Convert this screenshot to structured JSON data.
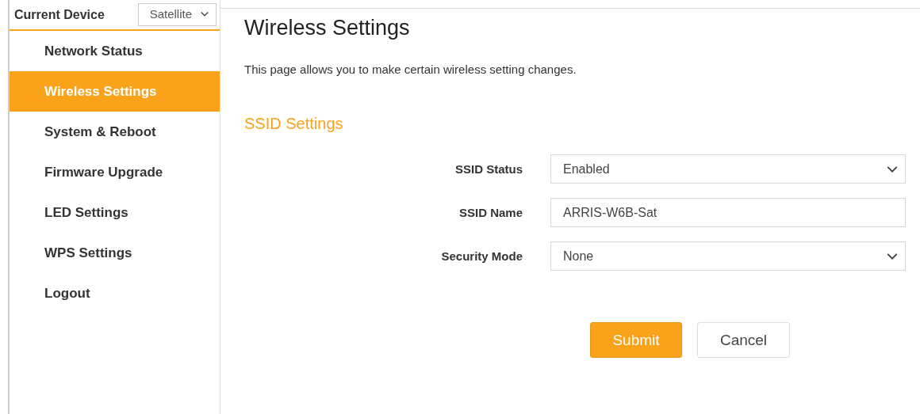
{
  "sidebar": {
    "device_label": "Current Device",
    "device_select": {
      "value": "Satellite"
    },
    "items": [
      {
        "label": "Network Status",
        "selected": false
      },
      {
        "label": "Wireless Settings",
        "selected": true
      },
      {
        "label": "System & Reboot",
        "selected": false
      },
      {
        "label": "Firmware Upgrade",
        "selected": false
      },
      {
        "label": "LED Settings",
        "selected": false
      },
      {
        "label": "WPS Settings",
        "selected": false
      },
      {
        "label": "Logout",
        "selected": false
      }
    ]
  },
  "main": {
    "title": "Wireless Settings",
    "description": "This page allows you to make certain wireless setting changes.",
    "section_title": "SSID Settings",
    "fields": [
      {
        "label": "SSID Status",
        "kind": "select",
        "value": "Enabled"
      },
      {
        "label": "SSID Name",
        "kind": "text",
        "value": "ARRIS-W6B-Sat"
      },
      {
        "label": "Security Mode",
        "kind": "select",
        "value": "None"
      }
    ],
    "buttons": [
      {
        "label": "Submit",
        "kind": "primary"
      },
      {
        "label": "Cancel",
        "kind": "secondary"
      }
    ]
  }
}
